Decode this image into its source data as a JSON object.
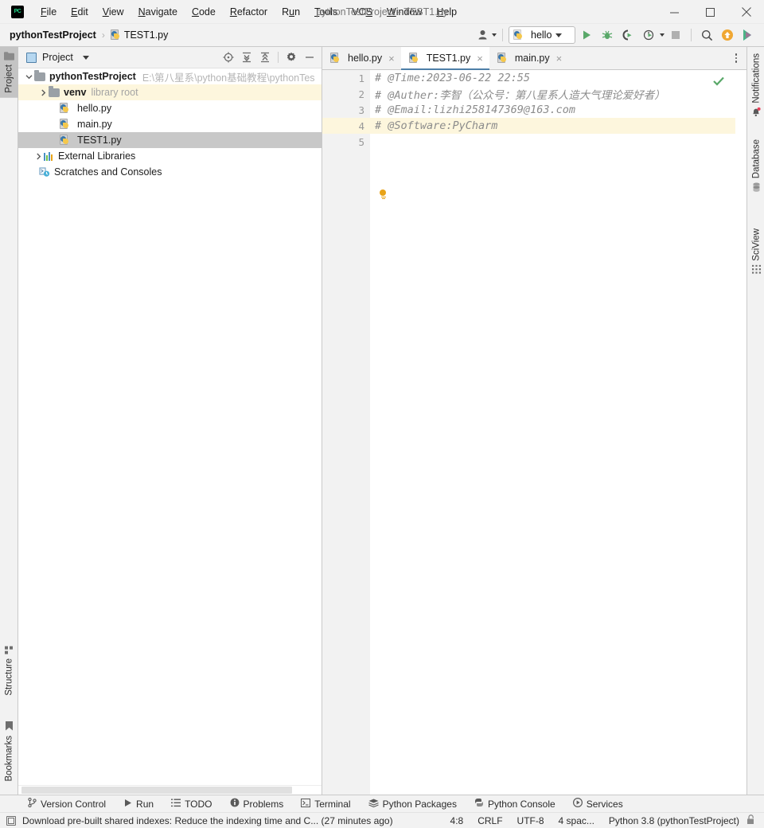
{
  "window": {
    "title": "pythonTestProject - TEST1.py",
    "logo": "pycharm-logo",
    "minimize": "minimize-icon",
    "maximize": "maximize-icon",
    "close": "close-icon"
  },
  "menu": [
    {
      "label": "File",
      "mnemonic": "F"
    },
    {
      "label": "Edit",
      "mnemonic": "E"
    },
    {
      "label": "View",
      "mnemonic": "V"
    },
    {
      "label": "Navigate",
      "mnemonic": "N"
    },
    {
      "label": "Code",
      "mnemonic": "C"
    },
    {
      "label": "Refactor",
      "mnemonic": "R"
    },
    {
      "label": "Run",
      "mnemonic": "u"
    },
    {
      "label": "Tools",
      "mnemonic": "T"
    },
    {
      "label": "VCS",
      "mnemonic": "S"
    },
    {
      "label": "Window",
      "mnemonic": "W"
    },
    {
      "label": "Help",
      "mnemonic": "H"
    }
  ],
  "breadcrumb": {
    "project": "pythonTestProject",
    "separator": "›",
    "file": "TEST1.py"
  },
  "toolbar": {
    "user_icon": "user-account-icon",
    "run_config": "hello",
    "run_icon": "run-icon",
    "debug_icon": "debug-icon",
    "coverage_icon": "run-with-coverage-icon",
    "profile_icon": "profile-icon",
    "stop_icon": "stop-icon",
    "search_icon": "search-everywhere-icon",
    "update_icon": "update-project-icon",
    "ai_icon": "ai-assistant-icon"
  },
  "left_stripe": {
    "top": [
      {
        "label": "Project",
        "icon": "project-folder-icon",
        "active": true
      }
    ],
    "bottom": [
      {
        "label": "Structure",
        "icon": "structure-icon"
      },
      {
        "label": "Bookmarks",
        "icon": "bookmark-icon"
      }
    ]
  },
  "right_stripe": [
    {
      "label": "Notifications",
      "icon": "notification-bell-icon"
    },
    {
      "label": "Database",
      "icon": "database-icon"
    },
    {
      "label": "SciView",
      "icon": "sciview-grid-icon"
    }
  ],
  "project_panel": {
    "title": "Project",
    "title_icon": "project-view-icon",
    "dropdown_icon": "chevron-down-icon",
    "tools": [
      {
        "name": "select-opened-file-icon"
      },
      {
        "name": "expand-all-icon"
      },
      {
        "name": "collapse-all-icon"
      },
      {
        "name": "settings-gear-icon"
      },
      {
        "name": "hide-panel-icon"
      }
    ],
    "tree": [
      {
        "label": "pythonTestProject",
        "path": "E:\\第八星系\\python基础教程\\pythonTes",
        "type": "project-root",
        "expanded": true,
        "depth": 0,
        "bold": true,
        "highlight": "none"
      },
      {
        "label": "venv",
        "sub": "library root",
        "type": "folder",
        "expanded": false,
        "depth": 1,
        "bold": true,
        "highlight": "yellow"
      },
      {
        "label": "hello.py",
        "type": "python-file",
        "depth": 2,
        "highlight": "none"
      },
      {
        "label": "main.py",
        "type": "python-file",
        "depth": 2,
        "highlight": "none"
      },
      {
        "label": "TEST1.py",
        "type": "python-file",
        "depth": 2,
        "highlight": "gray"
      },
      {
        "label": "External Libraries",
        "type": "libraries",
        "expanded": false,
        "depth": 0,
        "highlight": "none"
      },
      {
        "label": "Scratches and Consoles",
        "type": "scratches",
        "depth": 0,
        "highlight": "none"
      }
    ]
  },
  "editor": {
    "tabs": [
      {
        "label": "hello.py",
        "icon": "python-file-icon",
        "close": "×",
        "active": false
      },
      {
        "label": "TEST1.py",
        "icon": "python-file-icon",
        "close": "×",
        "active": true
      },
      {
        "label": "main.py",
        "icon": "python-file-icon",
        "close": "×",
        "active": false
      }
    ],
    "tabs_more_icon": "more-options-icon",
    "inspection_status_icon": "inspections-ok-check-icon",
    "intention_bulb_icon": "intention-bulb-icon",
    "lines": [
      {
        "num": "1",
        "text": "# @Time:2023-06-22 22:55",
        "fold": true,
        "current": false
      },
      {
        "num": "2",
        "text": "# @Auther:李智（公众号：第八星系人造大气理论爱好者）",
        "fold": false,
        "current": false
      },
      {
        "num": "3",
        "text": "# @Email:lizhi258147369@163.com",
        "fold": false,
        "current": false
      },
      {
        "num": "4",
        "text": "# @Software:PyCharm",
        "fold": true,
        "current": true
      },
      {
        "num": "5",
        "text": "",
        "fold": false,
        "current": false
      }
    ]
  },
  "tool_windows": [
    {
      "label": "Version Control",
      "icon": "branch-icon"
    },
    {
      "label": "Run",
      "icon": "run-triangle-icon"
    },
    {
      "label": "TODO",
      "icon": "todo-list-icon"
    },
    {
      "label": "Problems",
      "icon": "problems-warning-icon"
    },
    {
      "label": "Terminal",
      "icon": "terminal-icon"
    },
    {
      "label": "Python Packages",
      "icon": "packages-icon"
    },
    {
      "label": "Python Console",
      "icon": "python-console-icon"
    },
    {
      "label": "Services",
      "icon": "services-icon"
    }
  ],
  "status_bar": {
    "message_icon": "background-task-icon",
    "message": "Download pre-built shared indexes: Reduce the indexing time and C... (27 minutes ago)",
    "caret_position": "4:8",
    "line_separator": "CRLF",
    "encoding": "UTF-8",
    "indent": "4 spac...",
    "interpreter": "Python 3.8 (pythonTestProject)",
    "lock_icon": "lock-icon"
  },
  "colors": {
    "accent_blue": "#4e7fa8",
    "panel_bg": "#f2f2f2",
    "editor_bg": "#ffffff",
    "current_line": "#fdf6dd",
    "selection_gray": "#c8c8c8",
    "comment_gray": "#8c8c8c",
    "run_green": "#59a869",
    "bulb_orange": "#e8a317"
  }
}
